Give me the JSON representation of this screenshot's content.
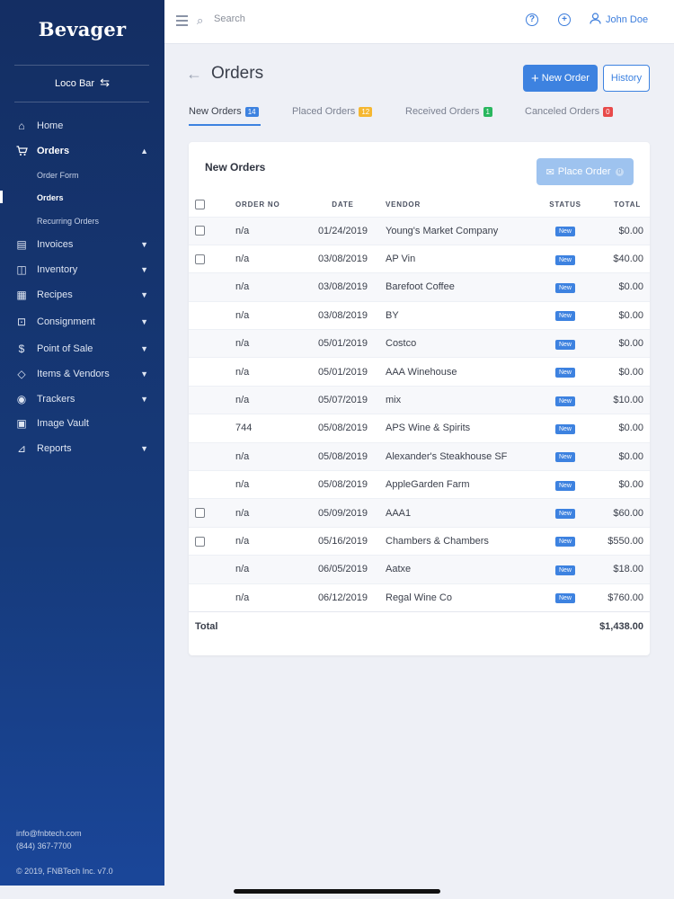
{
  "brand": "Bevager",
  "location": "Loco Bar",
  "sidebar": {
    "items": [
      {
        "label": "Home",
        "icon": "home-icon",
        "has_chevron": false
      },
      {
        "label": "Orders",
        "icon": "cart-icon",
        "has_chevron": true,
        "expanded": true
      },
      {
        "label": "Invoices",
        "icon": "invoice-icon",
        "has_chevron": true
      },
      {
        "label": "Inventory",
        "icon": "box-icon",
        "has_chevron": true
      },
      {
        "label": "Recipes",
        "icon": "book-icon",
        "has_chevron": true
      },
      {
        "label": "Consignment",
        "icon": "consignment-icon",
        "has_chevron": true
      },
      {
        "label": "Point of Sale",
        "icon": "dollar-icon",
        "has_chevron": true
      },
      {
        "label": "Items & Vendors",
        "icon": "tag-icon",
        "has_chevron": true
      },
      {
        "label": "Trackers",
        "icon": "location-pin-icon",
        "has_chevron": true
      },
      {
        "label": "Image Vault",
        "icon": "image-icon",
        "has_chevron": false
      },
      {
        "label": "Reports",
        "icon": "chart-icon",
        "has_chevron": true
      }
    ],
    "sub_items": [
      "Order Form",
      "Orders",
      "Recurring Orders"
    ],
    "footer": {
      "email": "info@fnbtech.com",
      "phone": "(844) 367-7700",
      "copyright": "© 2019, FNBTech Inc. v7.0"
    }
  },
  "topbar": {
    "search_placeholder": "Search",
    "user_name": "John Doe"
  },
  "page": {
    "title": "Orders",
    "new_order_label": "New Order",
    "history_label": "History"
  },
  "tabs": [
    {
      "label": "New Orders",
      "count": "14",
      "color": "#3d82e0"
    },
    {
      "label": "Placed Orders",
      "count": "12",
      "color": "#f5b731"
    },
    {
      "label": "Received Orders",
      "count": "1",
      "color": "#2ab75f"
    },
    {
      "label": "Canceled Orders",
      "count": "0",
      "color": "#e84a4a"
    }
  ],
  "card": {
    "title": "New Orders",
    "place_order_label": "Place Order",
    "place_order_count": "0"
  },
  "table": {
    "headers": [
      "ORDER NO",
      "DATE",
      "VENDOR",
      "STATUS",
      "TOTAL"
    ],
    "rows": [
      {
        "checkbox": true,
        "order_no": "n/a",
        "date": "01/24/2019",
        "vendor": "Young's Market Company",
        "status": "New",
        "total": "$0.00"
      },
      {
        "checkbox": true,
        "order_no": "n/a",
        "date": "03/08/2019",
        "vendor": "AP Vin",
        "status": "New",
        "total": "$40.00"
      },
      {
        "checkbox": false,
        "order_no": "n/a",
        "date": "03/08/2019",
        "vendor": "Barefoot Coffee",
        "status": "New",
        "total": "$0.00"
      },
      {
        "checkbox": false,
        "order_no": "n/a",
        "date": "03/08/2019",
        "vendor": "BY",
        "status": "New",
        "total": "$0.00"
      },
      {
        "checkbox": false,
        "order_no": "n/a",
        "date": "05/01/2019",
        "vendor": "Costco",
        "status": "New",
        "total": "$0.00"
      },
      {
        "checkbox": false,
        "order_no": "n/a",
        "date": "05/01/2019",
        "vendor": "AAA Winehouse",
        "status": "New",
        "total": "$0.00"
      },
      {
        "checkbox": false,
        "order_no": "n/a",
        "date": "05/07/2019",
        "vendor": "mix",
        "status": "New",
        "total": "$10.00"
      },
      {
        "checkbox": false,
        "order_no": "744",
        "date": "05/08/2019",
        "vendor": "APS Wine & Spirits",
        "status": "New",
        "total": "$0.00"
      },
      {
        "checkbox": false,
        "order_no": "n/a",
        "date": "05/08/2019",
        "vendor": "Alexander's Steakhouse SF",
        "status": "New",
        "total": "$0.00"
      },
      {
        "checkbox": false,
        "order_no": "n/a",
        "date": "05/08/2019",
        "vendor": "AppleGarden Farm",
        "status": "New",
        "total": "$0.00"
      },
      {
        "checkbox": true,
        "order_no": "n/a",
        "date": "05/09/2019",
        "vendor": "AAA1",
        "status": "New",
        "total": "$60.00"
      },
      {
        "checkbox": true,
        "order_no": "n/a",
        "date": "05/16/2019",
        "vendor": "Chambers & Chambers",
        "status": "New",
        "total": "$550.00"
      },
      {
        "checkbox": false,
        "order_no": "n/a",
        "date": "06/05/2019",
        "vendor": "Aatxe",
        "status": "New",
        "total": "$18.00"
      },
      {
        "checkbox": false,
        "order_no": "n/a",
        "date": "06/12/2019",
        "vendor": "Regal Wine Co",
        "status": "New",
        "total": "$760.00"
      }
    ],
    "total_label": "Total",
    "total_value": "$1,438.00"
  }
}
